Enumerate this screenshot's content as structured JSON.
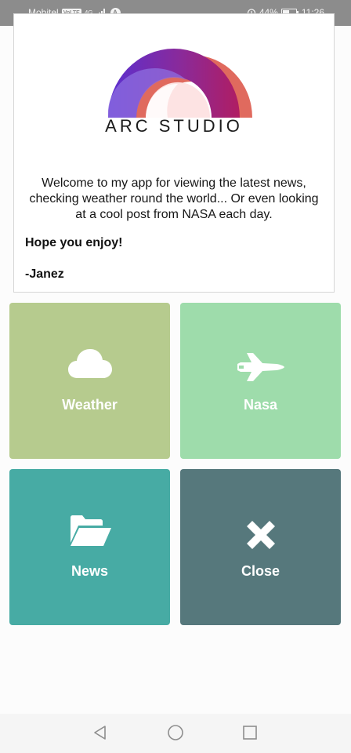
{
  "status_bar": {
    "carrier": "Mobitel",
    "volte": "VoLTE",
    "network": "4G",
    "app_badge": "A",
    "battery": "44%",
    "time": "11:26"
  },
  "card": {
    "brand": "ARC STUDIO",
    "intro": "Welcome to my app for viewing the latest news, checking weather round the world... Or even looking at a cool post from NASA each day.",
    "wish": "Hope you enjoy!",
    "signature": "-Janez"
  },
  "tiles": [
    {
      "label": "Weather",
      "icon": "cloud-icon",
      "color": "#b6cb8e"
    },
    {
      "label": "Nasa",
      "icon": "space-shuttle-icon",
      "color": "#9edcab"
    },
    {
      "label": "News",
      "icon": "folder-open-icon",
      "color": "#47aba4"
    },
    {
      "label": "Close",
      "icon": "close-icon",
      "color": "#56787c"
    }
  ],
  "colors": {
    "status_bar": "#8c8c8c",
    "nav_bar": "#f5f5f5",
    "logo_purple": "#6a2ec8",
    "logo_magenta": "#a21f72",
    "logo_coral": "#e06a5e"
  },
  "nav_bar": {
    "back_icon": "back-triangle-icon",
    "home_icon": "home-circle-icon",
    "recents_icon": "recents-square-icon"
  }
}
